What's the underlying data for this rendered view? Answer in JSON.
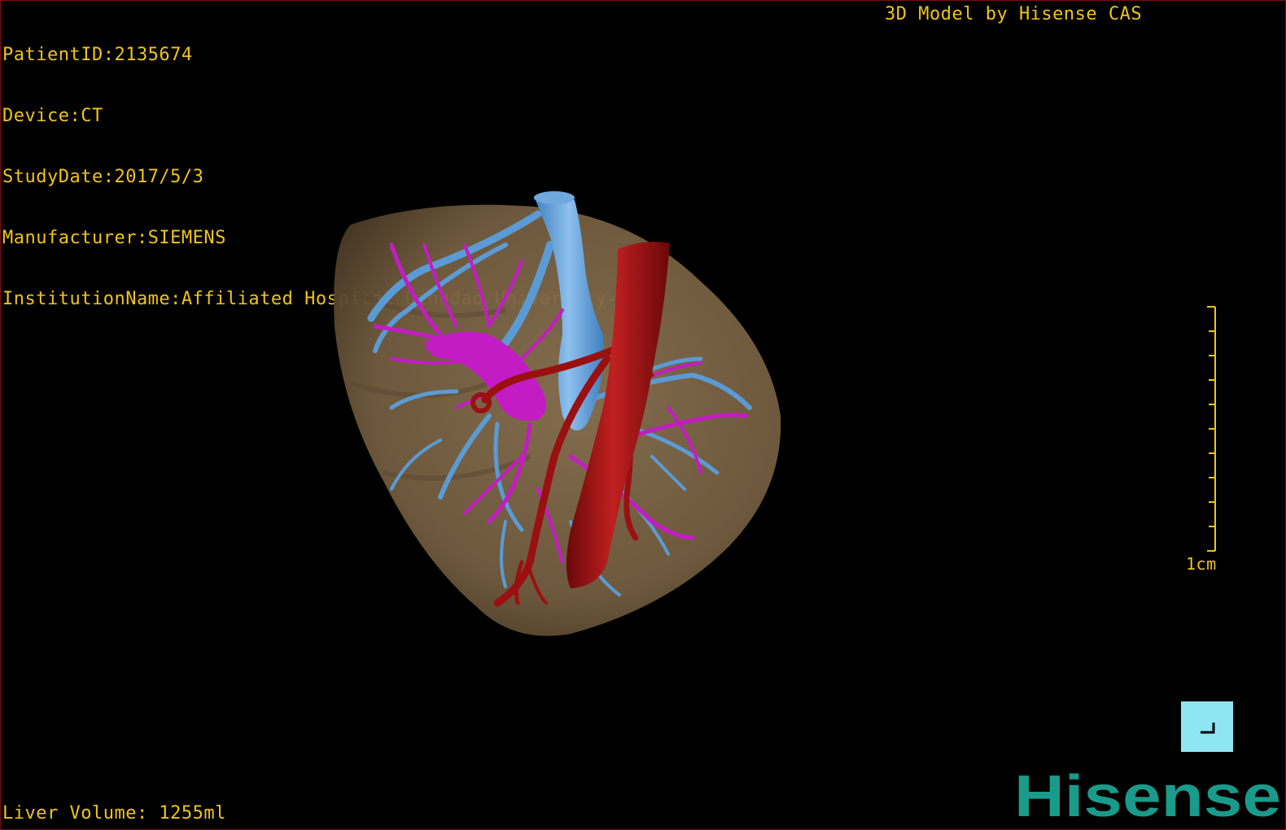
{
  "header": {
    "patient_id": "PatientID:2135674",
    "device": "Device:CT",
    "study_date": "StudyDate:2017/5/3",
    "manufacturer": "Manufacturer:SIEMENS",
    "institution": "InstitutionName:Affiliated Hospital Qingdao University-C",
    "model_credit": "3D Model by Hisense CAS"
  },
  "footer": {
    "liver_volume": "Liver Volume: 1255ml"
  },
  "scale": {
    "label": "1cm",
    "ticks": 10
  },
  "brand": {
    "logo_text": "Hisense",
    "logo_color": "#1a9a8a"
  },
  "colors": {
    "overlay_text": "#f0c419",
    "liver": "#7b6548",
    "portal_vein": "#5b9bd5",
    "hepatic_vein": "#c41cc4",
    "artery": "#9a1010",
    "reset_button": "#8fe6f3",
    "frame": "#7a1010"
  },
  "icons": {
    "reset_view": "corner-arrow-icon"
  }
}
